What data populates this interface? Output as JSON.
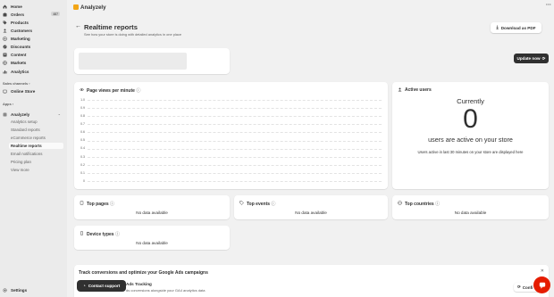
{
  "app": {
    "name": "Analyzely",
    "more_label": "···"
  },
  "sidebar": {
    "items": [
      {
        "label": "Home",
        "icon": "home-icon"
      },
      {
        "label": "Orders",
        "icon": "orders-icon",
        "badge": "487"
      },
      {
        "label": "Products",
        "icon": "tag-icon"
      },
      {
        "label": "Customers",
        "icon": "person-icon"
      },
      {
        "label": "Marketing",
        "icon": "target-icon"
      },
      {
        "label": "Discounts",
        "icon": "discount-icon"
      },
      {
        "label": "Content",
        "icon": "content-icon"
      },
      {
        "label": "Markets",
        "icon": "globe-icon"
      },
      {
        "label": "Analytics",
        "icon": "bar-chart-icon"
      }
    ],
    "sales_channels_label": "Sales channels",
    "online_store_label": "Online Store",
    "apps_label": "Apps",
    "app_name": "Analyzely",
    "sub_items": [
      "Analytics setup",
      "Standard reports",
      "eCommerce reports",
      "Realtime reports",
      "Email notifications",
      "Pricing plan",
      "View more"
    ],
    "settings_label": "Settings"
  },
  "page": {
    "title": "Realtime reports",
    "subtitle": "See how your store is doing with detailed analytics in one place",
    "download_label": "Download as PDF",
    "update_label": "Update now"
  },
  "page_views": {
    "title": "Page views per minute",
    "y_ticks": [
      "1.0",
      "0.9",
      "0.8",
      "0.7",
      "0.6",
      "0.5",
      "0.4",
      "0.3",
      "0.2",
      "0.1",
      "0"
    ]
  },
  "active_users": {
    "title": "Active users",
    "currently_label": "Currently",
    "count": "0",
    "users_text": "users are active on your store",
    "note": "Users active in last 30 minutes on your store are displayed here"
  },
  "cards": {
    "top_pages": "Top pages",
    "top_events": "Top events",
    "top_countries": "Top countries",
    "device_types": "Device types",
    "no_data": "No data available"
  },
  "ads_banner": {
    "title": "Track conversions and optimize your Google Ads campaigns",
    "row_title": "Ads Tracking",
    "row_desc": "ds conversions alongside your GA4 analytics data",
    "config_label": "Confi"
  },
  "contact_support_label": "Contact support",
  "colors": {
    "accent": "#303030",
    "chat": "#e51c00",
    "logo": "#f2a516"
  }
}
